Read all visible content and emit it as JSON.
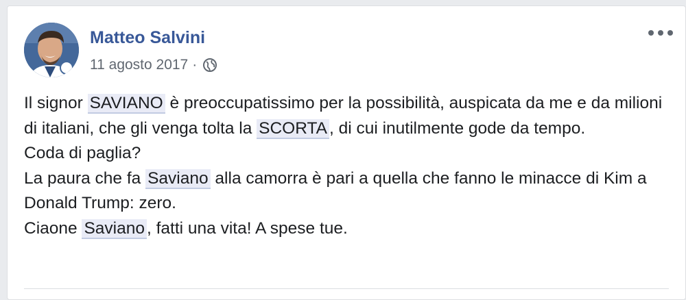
{
  "post": {
    "author": "Matteo Salvini",
    "date": "11 agosto 2017",
    "separator": "·",
    "privacy_icon": "globe-icon",
    "more_icon": "more-dots-icon",
    "lines": {
      "l1a": "Il signor ",
      "h1": "SAVIANO",
      "l1b": " è preoccupatissimo per la possibilità, auspicata da me e da milioni di italiani, che gli venga tolta la ",
      "h2": "SCORTA",
      "l1c": ", di cui inutilmente gode da tempo.",
      "l2": "Coda di paglia?",
      "l3a": "La paura che fa ",
      "h3": "Saviano",
      "l3b": " alla camorra è pari a quella che fanno le minacce di Kim a Donald Trump: zero.",
      "l4a": "Ciaone ",
      "h4": "Saviano",
      "l4b": ", fatti una vita! A spese tue."
    }
  },
  "colors": {
    "author": "#385898",
    "meta": "#606770",
    "text": "#1c1e21",
    "tag_bg": "#e9ebf6"
  }
}
